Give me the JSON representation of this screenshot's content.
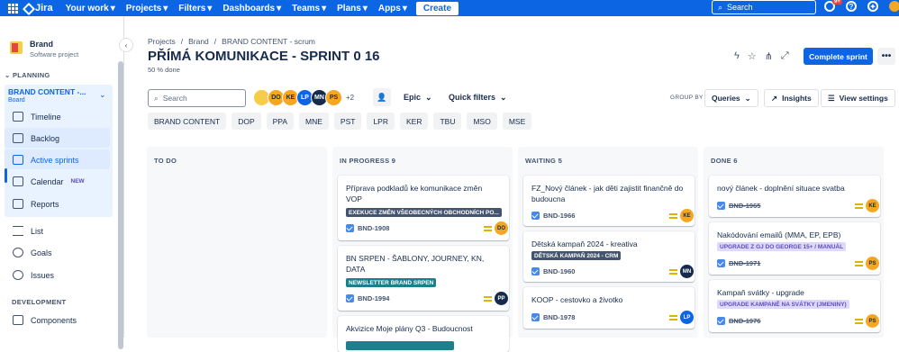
{
  "topbar": {
    "app_name": "Jira",
    "nav": [
      "Your work",
      "Projects",
      "Filters",
      "Dashboards",
      "Teams",
      "Plans",
      "Apps"
    ],
    "create_label": "Create",
    "search_placeholder": "Search",
    "notifications_badge": "9+"
  },
  "sidebar": {
    "project_name": "Brand",
    "project_type": "Software project",
    "planning_title": "PLANNING",
    "board_name": "BRAND CONTENT -...",
    "board_sub": "Board",
    "items": [
      {
        "label": "Timeline"
      },
      {
        "label": "Backlog"
      },
      {
        "label": "Active sprints"
      },
      {
        "label": "Calendar",
        "badge": "NEW"
      },
      {
        "label": "Reports"
      },
      {
        "label": "List"
      },
      {
        "label": "Goals"
      },
      {
        "label": "Issues"
      }
    ],
    "development_title": "DEVELOPMENT",
    "dev_items": [
      {
        "label": "Components"
      }
    ]
  },
  "header": {
    "breadcrumb": [
      "Projects",
      "/",
      "Brand",
      "/",
      "BRAND CONTENT - scrum"
    ],
    "title": "PŘÍMÁ KOMUNIKACE - SPRINT 0 16",
    "subtitle": "50 % done",
    "complete_label": "Complete sprint",
    "more_label": "•••"
  },
  "toolbar": {
    "search_placeholder": "Search",
    "avatars": [
      {
        "initials": "",
        "color": "#F5CD47"
      },
      {
        "initials": "DO",
        "color": "#F5A623"
      },
      {
        "initials": "KE",
        "color": "#F5A623"
      },
      {
        "initials": "LP",
        "color": "#0C66E4"
      },
      {
        "initials": "MN",
        "color": "#172B4D"
      },
      {
        "initials": "PS",
        "color": "#F5A623"
      }
    ],
    "more_avatars": "+2",
    "epic_label": "Epic",
    "quick_filters_label": "Quick filters",
    "group_by_label": "GROUP BY",
    "queries_label": "Queries",
    "insights_label": "Insights",
    "view_settings_label": "View settings"
  },
  "chips": [
    "BRAND CONTENT",
    "DOP",
    "PPA",
    "MNE",
    "PST",
    "LPR",
    "KER",
    "TBU",
    "MSO",
    "MSE"
  ],
  "columns": [
    {
      "title": "TO DO",
      "cards": []
    },
    {
      "title": "IN PROGRESS 9",
      "cards": [
        {
          "title": "Příprava podkladů ke komunikace změn VOP",
          "epic": "EXEKUCE ZMĚN VŠEOBECNÝCH OBCHODNÍCH PO...",
          "key": "BND-1908",
          "assignee": "DO"
        },
        {
          "title": "BN SRPEN - ŠABLONY, JOURNEY, KN, DATA",
          "epic": "NEWSLETTER BRAND SRPEN",
          "key": "BND-1994",
          "assignee": "PP"
        },
        {
          "title": "Akvizice Moje plány Q3 - Budoucnost",
          "epic": "",
          "key": "",
          "assignee": ""
        }
      ]
    },
    {
      "title": "WAITING 5",
      "cards": [
        {
          "title": "FZ_Nový článek - jak děti zajistit finančně do budoucna",
          "epic": "",
          "key": "BND-1966",
          "assignee": "KE"
        },
        {
          "title": "Dětská kampaň 2024 - kreativa",
          "epic": "DĚTSKÁ KAMPAŇ 2024 - CRM",
          "key": "BND-1960",
          "assignee": "MN"
        },
        {
          "title": "KOOP - cestovko a životko",
          "epic": "",
          "key": "BND-1978",
          "assignee": "LP"
        }
      ]
    },
    {
      "title": "DONE 6",
      "cards": [
        {
          "title": "nový článek - doplnění situace svatba",
          "epic": "",
          "key": "BND-1965",
          "assignee": "KE"
        },
        {
          "title": "Nakódování emailů (MMA, EP, EPB)",
          "epic": "UPGRADE Z GJ DO GEORGE 15+ / MANUÁL",
          "key": "BND-1971",
          "assignee": "PS"
        },
        {
          "title": "Kampaň svátky - upgrade",
          "epic": "UPGRADE KAMPANĚ NA SVÁTKY (JMENINY)",
          "key": "BND-1976",
          "assignee": "PS"
        }
      ]
    }
  ]
}
